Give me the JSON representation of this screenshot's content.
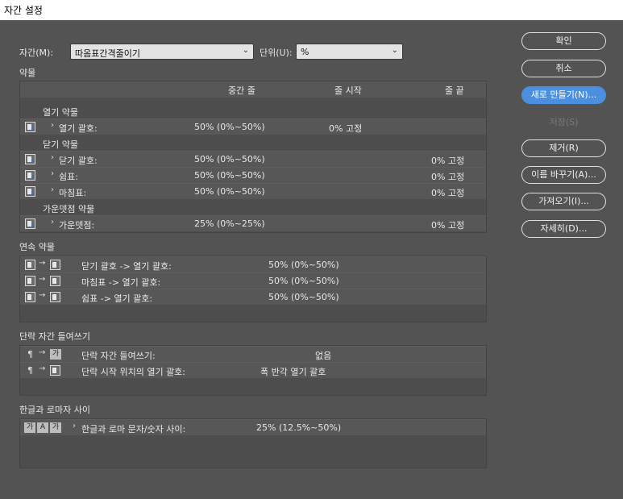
{
  "window": {
    "title": "자간 설정"
  },
  "top": {
    "jagan_label": "자간(M):",
    "jagan_value": "따옴표간격줄이기",
    "unit_label": "단위(U):",
    "unit_value": "%"
  },
  "punct": {
    "section_label": "약물",
    "headers": [
      "중간 줄",
      "줄 시작",
      "줄 끝"
    ],
    "groups": [
      {
        "name": "열기 약물",
        "rows": [
          {
            "name": "열기 괄호:",
            "mid": "50% (0%~50%)",
            "start": "0% 고정",
            "end": ""
          }
        ]
      },
      {
        "name": "닫기 약물",
        "rows": [
          {
            "name": "닫기 괄호:",
            "mid": "50% (0%~50%)",
            "start": "",
            "end": "0% 고정"
          },
          {
            "name": "쉼표:",
            "mid": "50% (0%~50%)",
            "start": "",
            "end": "0% 고정"
          },
          {
            "name": "마침표:",
            "mid": "50% (0%~50%)",
            "start": "",
            "end": "0% 고정"
          }
        ]
      },
      {
        "name": "가운뎃점 약물",
        "rows": [
          {
            "name": "가운뎃점:",
            "mid": "25% (0%~25%)",
            "start": "",
            "end": "0% 고정"
          }
        ]
      }
    ]
  },
  "consecutive": {
    "section_label": "연속 약물",
    "rows": [
      {
        "name": "닫기 괄호 -> 열기 괄호:",
        "value": "50% (0%~50%)"
      },
      {
        "name": "마침표 -> 열기 괄호:",
        "value": "50% (0%~50%)"
      },
      {
        "name": "쉼표 -> 열기 괄호:",
        "value": "50% (0%~50%)"
      }
    ]
  },
  "indent": {
    "section_label": "단락 자간 들여쓰기",
    "rows": [
      {
        "name": "단락 자간 들여쓰기:",
        "value": "없음"
      },
      {
        "name": "단락 시작 위치의 열기 괄호:",
        "value": "폭 반각 열기 괄호"
      }
    ]
  },
  "hangul": {
    "section_label": "한글과 로마자 사이",
    "rows": [
      {
        "name": "한글과 로마 문자/숫자 사이:",
        "value": "25% (12.5%~50%)"
      }
    ]
  },
  "icons": {
    "ga_glyph": "가",
    "a_glyph": "A",
    "pilcrow": "¶",
    "arrow": "→",
    "chevron": "›"
  },
  "buttons": {
    "ok": "확인",
    "cancel": "취소",
    "new": "새로 만들기(N)...",
    "save": "저장(S)",
    "remove": "제거(R)",
    "rename": "이름 바꾸기(A)...",
    "import": "가져오기(I)...",
    "detail": "자세히(D)..."
  },
  "colors": {
    "accent": "#4a8fe0",
    "background": "#535353"
  }
}
